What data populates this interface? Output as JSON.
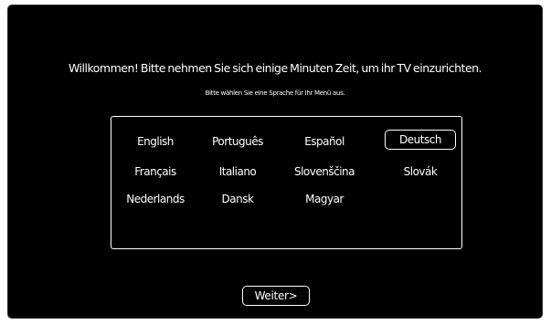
{
  "setup": {
    "welcome": "Willkommen! Bitte nehmen Sie sich einige Minuten Zeit, um ihr TV einzurichten.",
    "subtitle": "Bitte wählen Sie eine Sprache für Ihr Menü aus."
  },
  "languages": [
    "English",
    "Português",
    "Español",
    "Deutsch",
    "Français",
    "Italiano",
    "Slovenščina",
    "Slovák",
    "Nederlands",
    "Dansk",
    "Magyar"
  ],
  "selected_language": "Deutsch",
  "next_button": "Weiter>",
  "colors": {
    "background": "#000000",
    "foreground": "#ffffff"
  }
}
